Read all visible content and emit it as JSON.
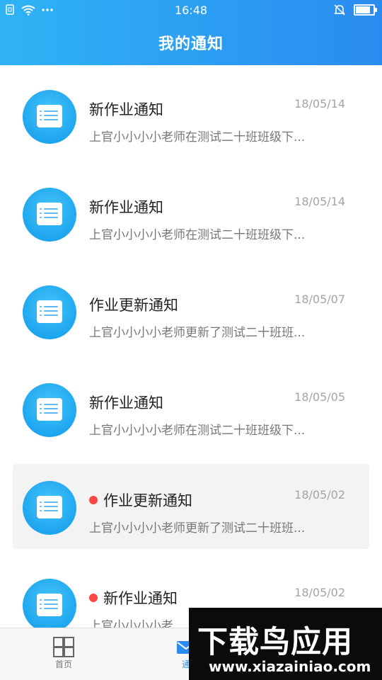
{
  "status_bar": {
    "time": "16:48",
    "left_icons": [
      "sim-icon",
      "wifi-icon",
      "more-dots-icon"
    ],
    "right_icons": [
      "mute-bell-icon",
      "battery-icon"
    ],
    "battery_level": 0.9
  },
  "header": {
    "title": "我的通知"
  },
  "notifications": [
    {
      "title": "新作业通知",
      "date": "18/05/14",
      "summary": "上官小小小小老师在测试二十班班级下...",
      "unread": false,
      "highlighted": false
    },
    {
      "title": "新作业通知",
      "date": "18/05/14",
      "summary": "上官小小小小老师在测试二十班班级下...",
      "unread": false,
      "highlighted": false
    },
    {
      "title": "作业更新通知",
      "date": "18/05/07",
      "summary": "上官小小小小老师更新了测试二十班班...",
      "unread": false,
      "highlighted": false
    },
    {
      "title": "新作业通知",
      "date": "18/05/05",
      "summary": "上官小小小小老师在测试二十班班级下...",
      "unread": false,
      "highlighted": false
    },
    {
      "title": "作业更新通知",
      "date": "18/05/02",
      "summary": "上官小小小小老师更新了测试二十班班...",
      "unread": true,
      "highlighted": true
    },
    {
      "title": "新作业通知",
      "date": "18/05/02",
      "summary": "上官小小小小老",
      "unread": true,
      "highlighted": false
    }
  ],
  "bottom_nav": {
    "items": [
      {
        "label": "首页",
        "icon": "grid-icon"
      },
      {
        "label": "通",
        "icon": "mail-icon"
      }
    ],
    "active_color": "#2a8cf0"
  },
  "watermark": {
    "brand": "下载鸟应用",
    "url": "www.xiazainiao.com"
  },
  "colors": {
    "header_start": "#2fb3f5",
    "header_end": "#2a8cf0",
    "unread_dot": "#ff4646"
  }
}
